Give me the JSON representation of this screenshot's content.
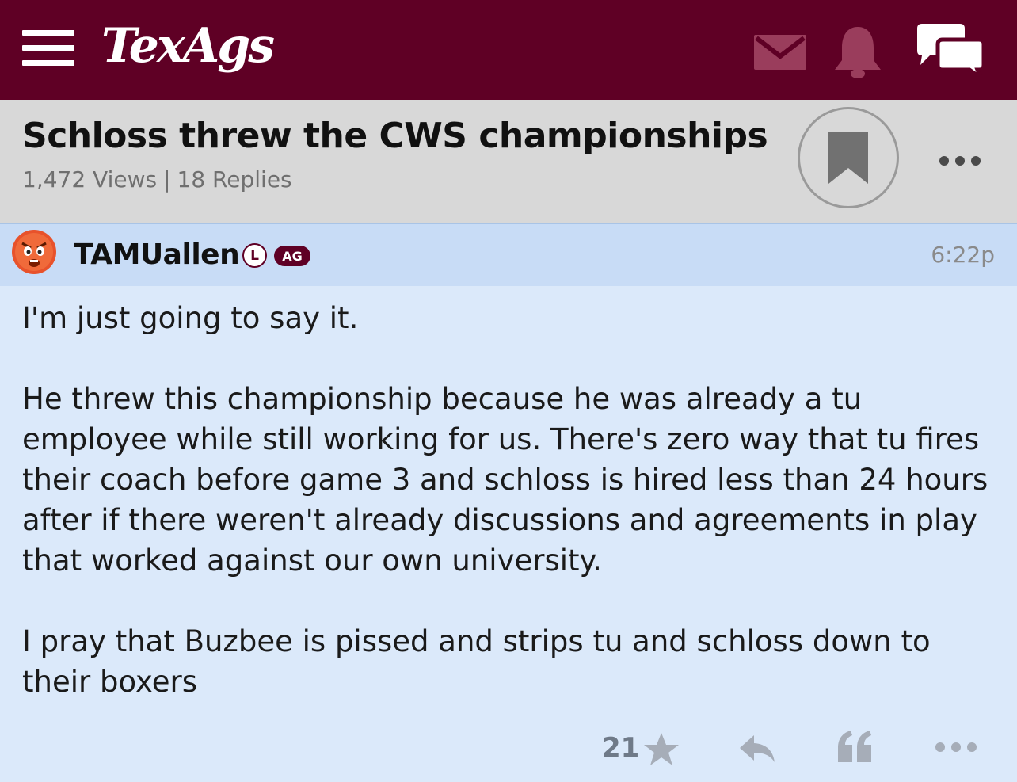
{
  "header": {
    "app_name": "TexAgs",
    "menu_icon": "hamburger-menu-icon",
    "mail_icon": "envelope-icon",
    "notifications_icon": "bell-icon",
    "chat_icon": "chat-bubbles-icon",
    "brand_color": "#5f0025"
  },
  "thread": {
    "title": "Schloss threw the CWS championships",
    "views": "1,472 Views",
    "separator": "|",
    "replies": "18 Replies",
    "bookmark_icon": "bookmark-icon",
    "more_icon": "more-horizontal-icon"
  },
  "post": {
    "avatar_icon": "angry-face-icon",
    "username": "TAMUallen",
    "badge_l": "L",
    "badge_ag": "AG",
    "time": "6:22p",
    "paragraphs": [
      "I'm just going to say it.",
      "He threw this championship because he was already a tu employee while still working for us. There's zero way that tu fires their coach before game 3 and schloss is hired less than 24 hours after if there weren't already discussions and agreements in play that worked against our own university.",
      "I pray that Buzbee is pissed and strips tu and schloss down to their boxers"
    ],
    "star_count": "21",
    "star_icon": "star-icon",
    "reply_icon": "reply-arrow-icon",
    "quote_icon": "quote-icon",
    "post_more_icon": "more-horizontal-icon"
  },
  "colors": {
    "header_bg": "#5f0025",
    "title_bg": "#d8d8d8",
    "post_header_bg": "#c8dcf6",
    "post_bg": "#dbe9fa",
    "muted_icon": "#a6adb8"
  }
}
